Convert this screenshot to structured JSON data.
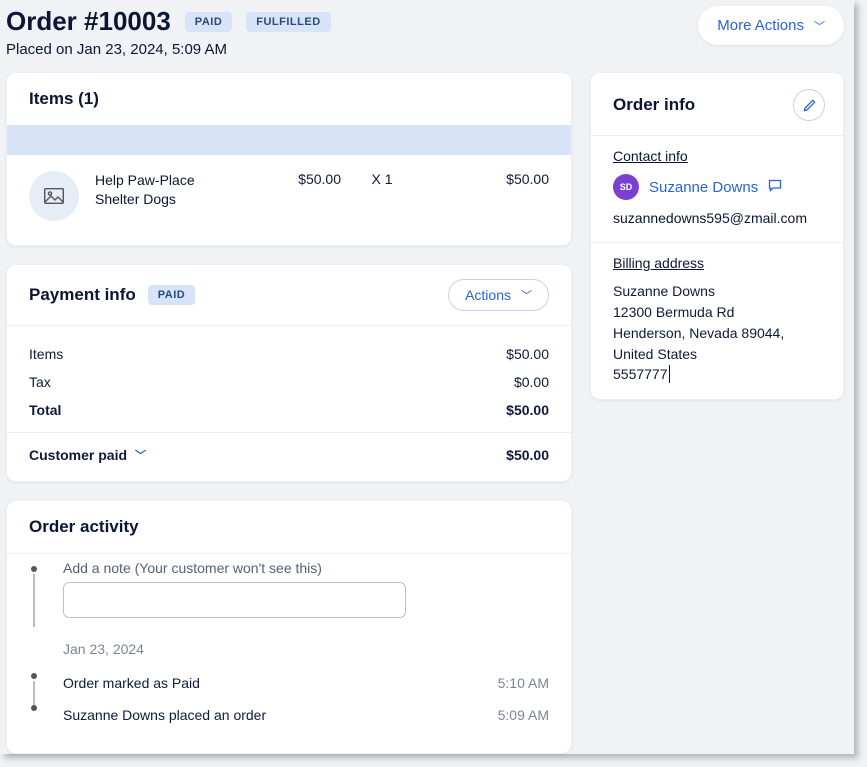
{
  "header": {
    "title": "Order #10003",
    "badges": {
      "paid": "PAID",
      "fulfilled": "FULFILLED"
    },
    "placed_on": "Placed on Jan 23, 2024, 5:09 AM",
    "more_actions": "More Actions"
  },
  "items_card": {
    "title": "Items (1)",
    "row": {
      "name": "Help Paw-Place Shelter Dogs",
      "unit_price": "$50.00",
      "qty": "X 1",
      "line_total": "$50.00"
    }
  },
  "payment": {
    "title": "Payment info",
    "badge": "PAID",
    "actions_label": "Actions",
    "lines": {
      "items_label": "Items",
      "items_value": "$50.00",
      "tax_label": "Tax",
      "tax_value": "$0.00",
      "total_label": "Total",
      "total_value": "$50.00"
    },
    "customer_paid_label": "Customer paid",
    "customer_paid_value": "$50.00"
  },
  "activity": {
    "title": "Order activity",
    "note_label": "Add a note (Your customer won't see this)",
    "date": "Jan 23, 2024",
    "events": [
      {
        "text": "Order marked as Paid",
        "time": "5:10 AM"
      },
      {
        "text": "Suzanne Downs placed an order",
        "time": "5:09 AM"
      }
    ]
  },
  "order_info": {
    "title": "Order info",
    "contact_heading": "Contact info",
    "avatar_initials": "SD",
    "contact_name": "Suzanne Downs",
    "email": "suzannedowns595@zmail.com",
    "billing_heading": "Billing address",
    "billing_name": "Suzanne Downs",
    "billing_street": "12300 Bermuda Rd",
    "billing_city": "Henderson, Nevada 89044, United States",
    "phone": "5557777"
  }
}
